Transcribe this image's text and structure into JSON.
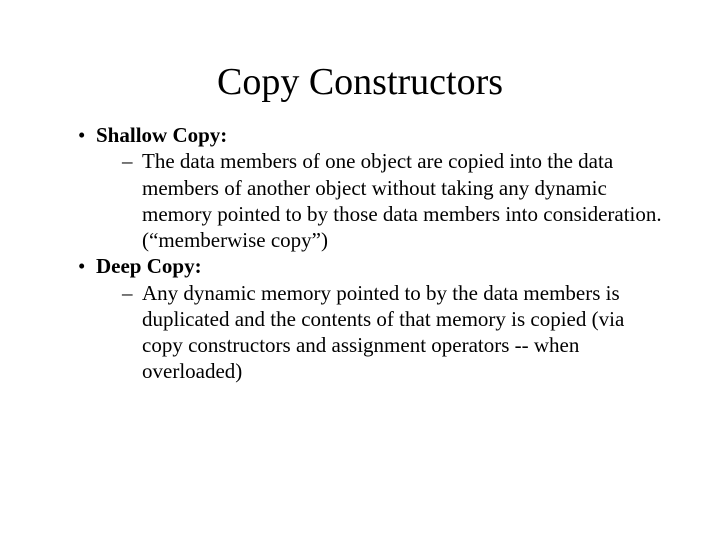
{
  "title": "Copy Constructors",
  "bullets": [
    {
      "label": "Shallow Copy:",
      "sub": "The data members of one object are copied into the data members of another object without taking any dynamic memory pointed to by those data members into consideration. (“memberwise copy”)"
    },
    {
      "label": "Deep Copy:",
      "sub": "Any dynamic memory pointed to by the data members is duplicated and the contents of that memory is copied (via copy constructors and assignment operators -- when overloaded)"
    }
  ]
}
